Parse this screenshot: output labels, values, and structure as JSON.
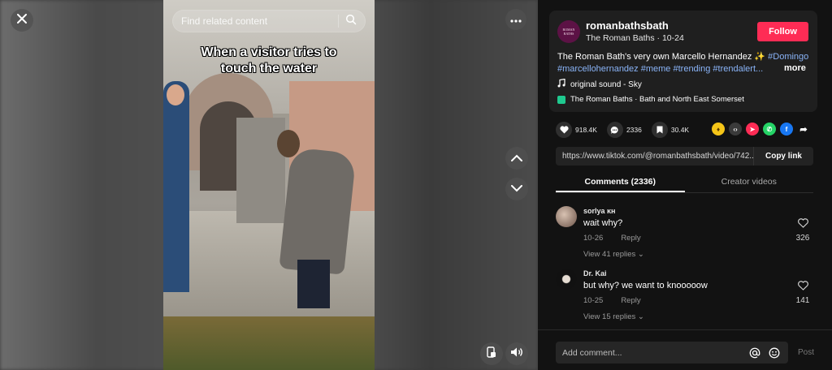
{
  "search": {
    "placeholder": "Find related content"
  },
  "video": {
    "caption": "When a visitor tries to\ntouch the water"
  },
  "author": {
    "avatar_text": "ROMAN BATHS",
    "username": "romanbathsbath",
    "subline": "The Roman Baths · 10-24",
    "follow_label": "Follow"
  },
  "description": {
    "text": "The Roman Bath's very own Marcello Hernandez ✨",
    "tags": [
      "#Domingo",
      "#marcellohernandez",
      "#meme",
      "#trending",
      "#trendalert..."
    ],
    "more_label": "more"
  },
  "sound": {
    "label": "original sound - Sky"
  },
  "location": {
    "label": "The Roman Baths · Bath and North East Somerset"
  },
  "stats": {
    "likes": "918.4K",
    "comments": "2336",
    "saves": "30.4K"
  },
  "share": {
    "link": "https://www.tiktok.com/@romanbathsbath/video/742...",
    "copy_label": "Copy link"
  },
  "tabs": [
    {
      "label": "Comments (2336)",
      "active": true
    },
    {
      "label": "Creator videos",
      "active": false
    }
  ],
  "comments": [
    {
      "name": "sorlya ĸн",
      "text": "wait why?",
      "date": "10-26",
      "reply": "Reply",
      "replies": "View 41 replies",
      "likes": "326"
    },
    {
      "name": "Dr. Kai",
      "text": "but why? we want to knooooow",
      "date": "10-25",
      "reply": "Reply",
      "replies": "View 15 replies",
      "likes": "141"
    }
  ],
  "composer": {
    "placeholder": "Add comment...",
    "post_label": "Post"
  },
  "colors": {
    "accent": "#fe2c55",
    "hashtag": "#8ab4f8",
    "panel": "#121212"
  }
}
